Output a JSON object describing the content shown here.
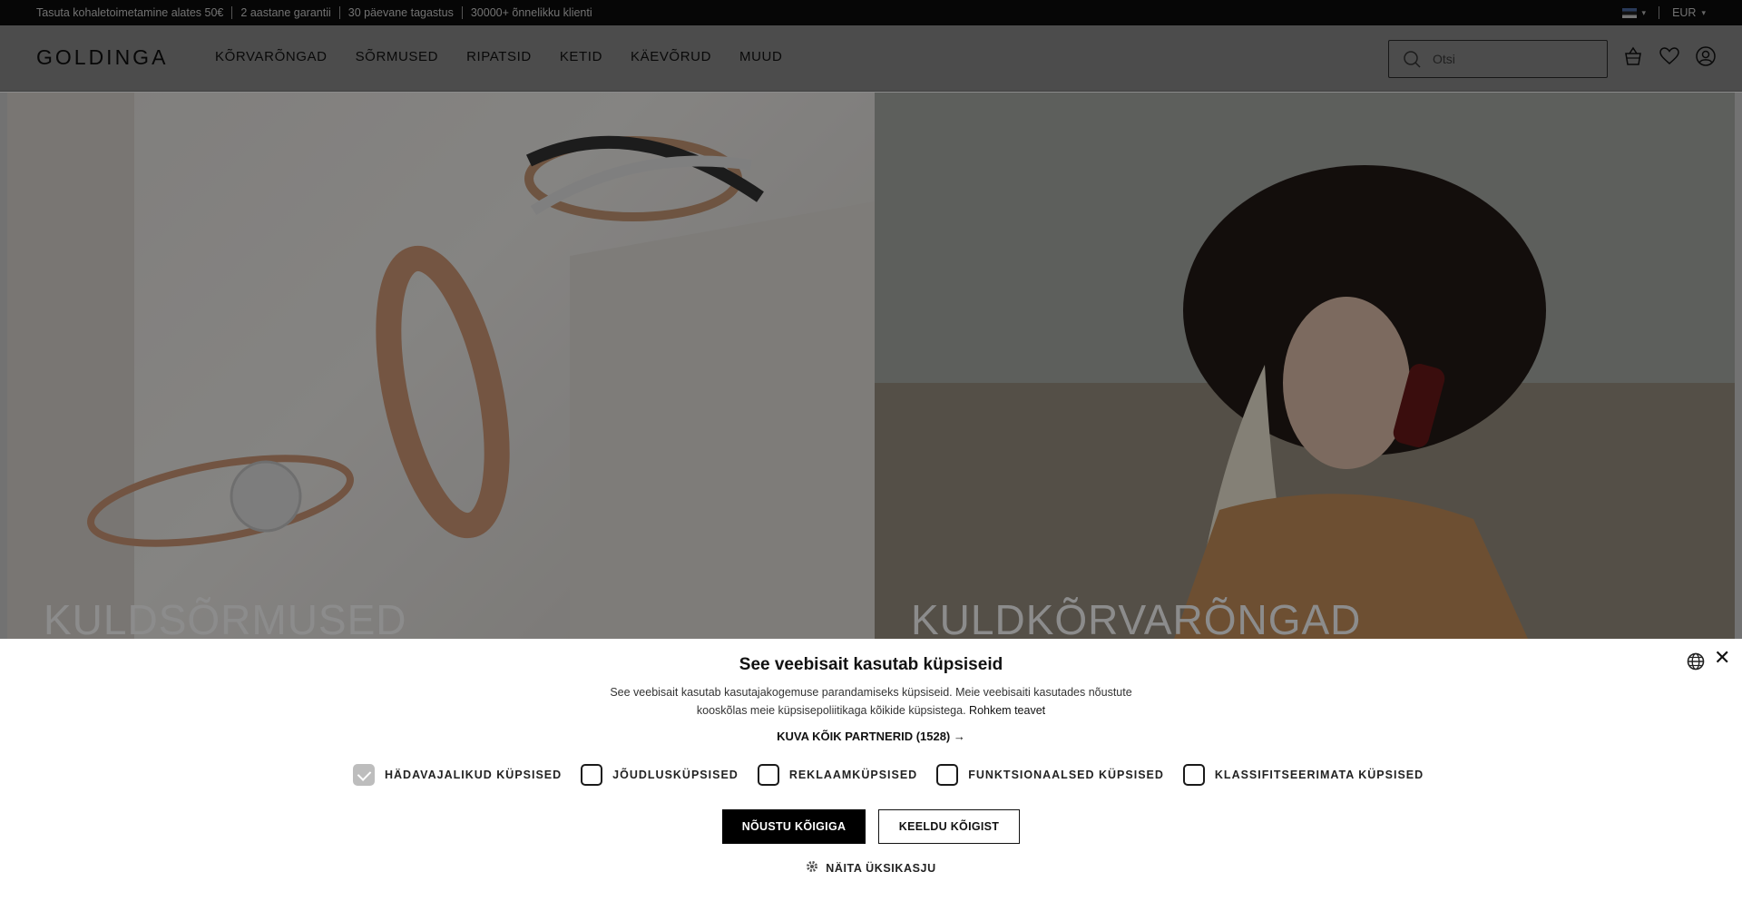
{
  "topbar": {
    "messages": [
      "Tasuta kohaletoimetamine alates 50€",
      "2 aastane garantii",
      "30 päevane tagastus",
      "30000+ õnnelikku klienti"
    ],
    "currency": "EUR"
  },
  "header": {
    "logo": "GOLDINGA",
    "nav": [
      "KÕRVARÕNGAD",
      "SÕRMUSED",
      "RIPATSID",
      "KETID",
      "KÄEVÕRUD",
      "MUUD"
    ],
    "search_placeholder": "Otsi"
  },
  "hero": {
    "left_title": "KULDSÕRMUSED",
    "right_title": "KULDKÕRVARÕNGAD"
  },
  "cookie": {
    "title": "See veebisait kasutab küpsiseid",
    "desc_line1": "See veebisait kasutab kasutajakogemuse parandamiseks küpsiseid. Meie veebisaiti kasutades nõustute",
    "desc_line2": "kooskõlas meie küpsisepoliitikaga kõikide küpsistega.",
    "more_link": "Rohkem teavet",
    "partners": "KUVA KÕIK PARTNERID (1528) →",
    "checkboxes": [
      {
        "label": "HÄDAVAJALIKUD KÜPSISED",
        "checked": true
      },
      {
        "label": "JÕUDLUSKÜPSISED",
        "checked": false
      },
      {
        "label": "REKLAAMKÜPSISED",
        "checked": false
      },
      {
        "label": "FUNKTSIONAALSED KÜPSISED",
        "checked": false
      },
      {
        "label": "KLASSIFITSEERIMATA KÜPSISED",
        "checked": false
      }
    ],
    "accept": "NÕUSTU KÕIGIGA",
    "decline": "KEELDU KÕIGIST",
    "details": "NÄITA ÜKSIKASJU"
  }
}
